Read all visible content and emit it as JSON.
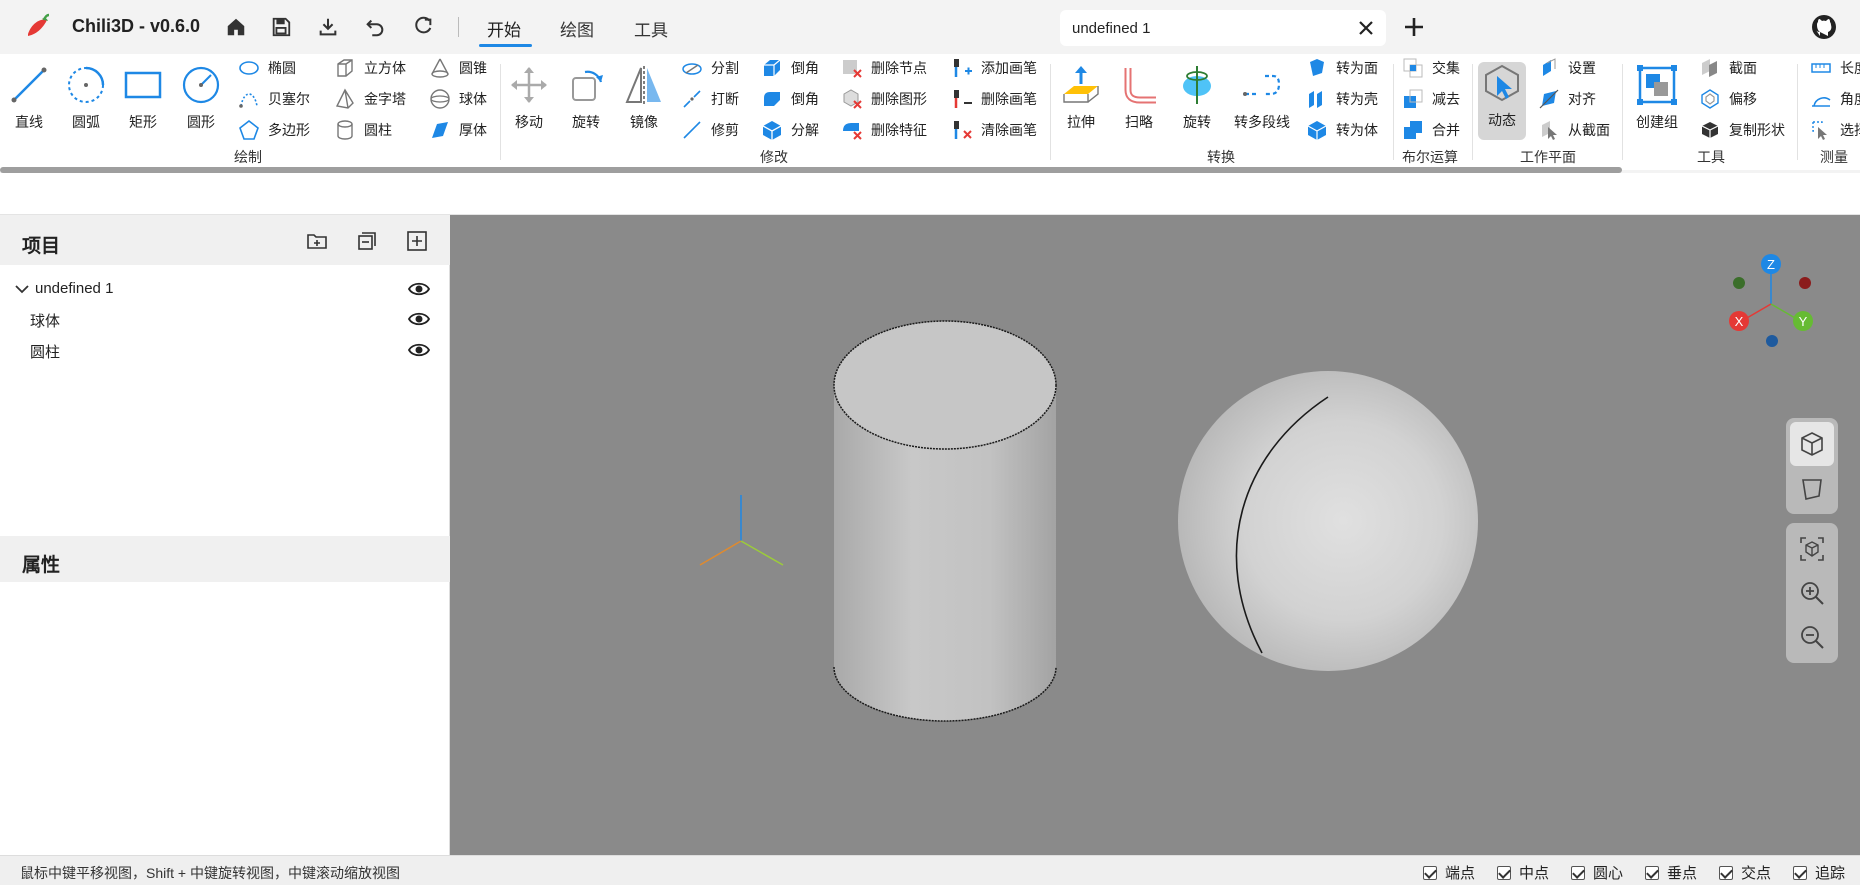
{
  "app": {
    "title": "Chili3D - v0.6.0"
  },
  "tabs": [
    "开始",
    "绘图",
    "工具"
  ],
  "document": {
    "name": "undefined 1"
  },
  "colors": {
    "accent": "#1e88e5",
    "viewport_bg": "#8a8a8a",
    "axis_x": "#e53935",
    "axis_y": "#66bb33",
    "axis_z": "#1e88e5"
  },
  "ribbon": {
    "draw": {
      "line": "直线",
      "arc": "圆弧",
      "rect": "矩形",
      "circle": "圆形",
      "ellipse": "椭圆",
      "bezier": "贝塞尔",
      "polygon": "多边形",
      "box": "立方体",
      "pyramid": "金字塔",
      "cylinder": "圆柱",
      "cone": "圆锥",
      "sphere": "球体",
      "thickness": "厚体",
      "group": "绘制"
    },
    "modify": {
      "move": "移动",
      "rotate": "旋转",
      "mirror": "镜像",
      "split": "分割",
      "break": "打断",
      "trim": "修剪",
      "chamfer": "倒角",
      "fillet": "倒角",
      "explode": "分解",
      "remove_node": "删除节点",
      "remove_shape": "删除图形",
      "remove_feature": "删除特征",
      "add_brush": "添加画笔",
      "remove_brush": "删除画笔",
      "clear_brush": "清除画笔",
      "group": "修改"
    },
    "convert": {
      "extrude": "拉伸",
      "sweep": "扫略",
      "revolve": "旋转",
      "polyline": "转多段线",
      "to_face": "转为面",
      "to_shell": "转为壳",
      "to_solid": "转为体",
      "group": "转换"
    },
    "boolean": {
      "intersect": "交集",
      "subtract": "减去",
      "union": "合并",
      "group": "布尔运算"
    },
    "workplane": {
      "dynamic": "动态",
      "settings": "设置",
      "align": "对齐",
      "from_section": "从截面",
      "group": "工作平面"
    },
    "tools": {
      "create_group": "创建组",
      "section": "截面",
      "offset": "偏移",
      "copy_shape": "复制形状",
      "group": "工具"
    },
    "measure": {
      "length": "长度",
      "angle": "角度",
      "select": "选择",
      "group": "测量"
    }
  },
  "project_panel": {
    "title": "项目",
    "root": "undefined 1",
    "items": [
      "球体",
      "圆柱"
    ]
  },
  "properties_panel": {
    "title": "属性"
  },
  "viewcube": {
    "x": "X",
    "y": "Y",
    "z": "Z"
  },
  "status": {
    "hint": "鼠标中键平移视图，Shift + 中键旋转视图，中键滚动缩放视图",
    "snaps": [
      "端点",
      "中点",
      "圆心",
      "垂点",
      "交点",
      "追踪"
    ]
  }
}
